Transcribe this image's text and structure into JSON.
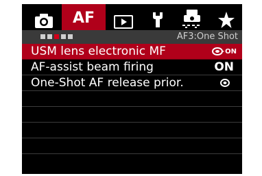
{
  "tabs": [
    {
      "id": "shooting",
      "icon": "camera-icon",
      "label": ""
    },
    {
      "id": "af",
      "icon": "",
      "label": "AF"
    },
    {
      "id": "playback",
      "icon": "playback-icon",
      "label": ""
    },
    {
      "id": "setup",
      "icon": "wrench-icon",
      "label": ""
    },
    {
      "id": "custom",
      "icon": "custom-function-icon",
      "label": ""
    },
    {
      "id": "mymenu",
      "icon": "star-icon",
      "label": ""
    }
  ],
  "subtabs": {
    "count": 5,
    "active_index": 2
  },
  "menu_title": "AF3:One Shot",
  "rows": [
    {
      "label": "USM lens electronic MF",
      "value_icon": "manual-focus-after-af-icon",
      "value_text": "ON"
    },
    {
      "label": "AF-assist beam firing",
      "value_text": "ON"
    },
    {
      "label": "One-Shot AF release prior.",
      "value_icon": "focus-priority-icon"
    },
    {
      "label": ""
    },
    {
      "label": ""
    },
    {
      "label": ""
    },
    {
      "label": ""
    },
    {
      "label": ""
    }
  ],
  "colors": {
    "accent": "#b0001a",
    "background": "#000000",
    "subbar": "#3a3a3a",
    "text": "#ffffff"
  }
}
